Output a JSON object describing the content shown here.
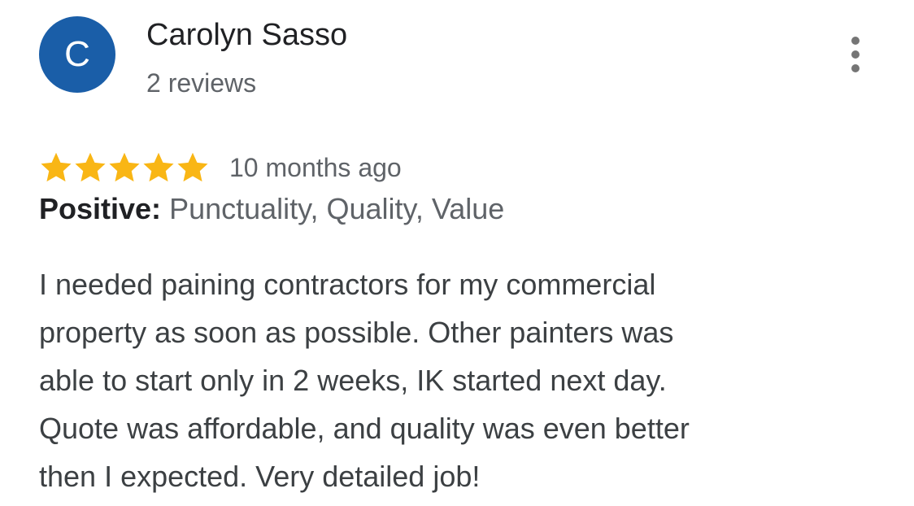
{
  "reviewer": {
    "initial": "C",
    "name": "Carolyn Sasso",
    "review_count": "2 reviews",
    "avatar_color": "#1a5ea8"
  },
  "menu": {
    "icon": "more-vert-icon",
    "color": "#757575"
  },
  "rating": {
    "stars": 5,
    "max_stars": 5,
    "star_color": "#f9b615",
    "date": "10 months ago"
  },
  "positive": {
    "label": "Positive:",
    "values": "Punctuality, Quality, Value"
  },
  "review": {
    "text": "I needed paining contractors for my commercial\nproperty as soon as possible. Other painters was\nable to start only in 2 weeks, IK started next day.\nQuote was affordable, and quality was even better\nthen I expected. Very detailed job!"
  }
}
